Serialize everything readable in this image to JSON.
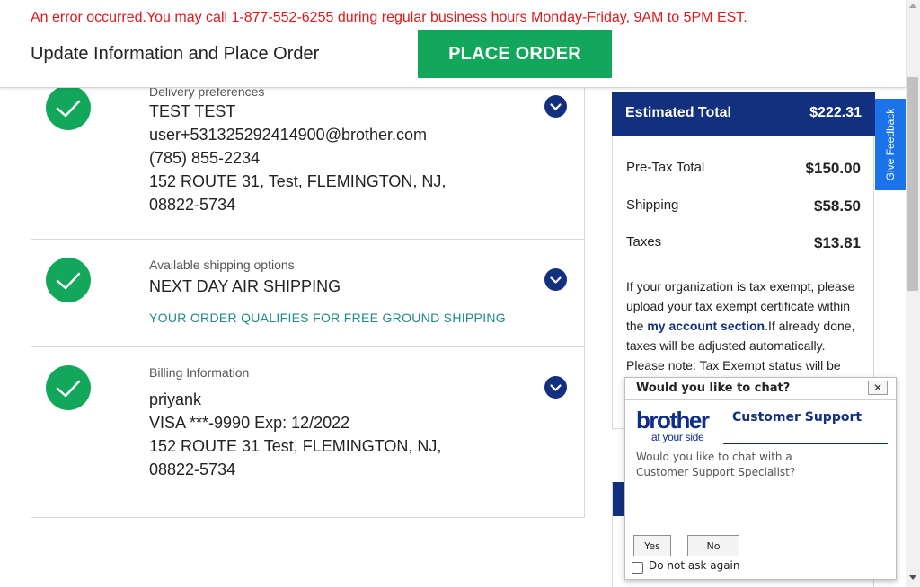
{
  "header": {
    "error_message": "An error occurred.You may call 1-877-552-6255 during regular business hours Monday-Friday, 9AM to 5PM EST.",
    "title": "Update Information and Place Order",
    "place_order_label": "PLACE ORDER"
  },
  "sections": {
    "delivery": {
      "label": "Delivery preferences",
      "lines": [
        "TEST TEST",
        "user+531325292414900@brother.com",
        "(785) 855-2234",
        "152 ROUTE 31, Test, FLEMINGTON, NJ,",
        "08822-5734"
      ]
    },
    "shipping": {
      "label": "Available shipping options",
      "option": "NEXT DAY AIR SHIPPING",
      "note": "YOUR ORDER QUALIFIES FOR FREE GROUND SHIPPING"
    },
    "billing": {
      "label": "Billing Information",
      "lines": [
        "priyank",
        "VISA ***-9990 Exp: 12/2022",
        "152 ROUTE 31 Test, FLEMINGTON, NJ,",
        "08822-5734"
      ]
    }
  },
  "summary": {
    "estimated_total_label": "Estimated Total",
    "estimated_total_value": "$222.31",
    "rows": [
      {
        "label": "Pre-Tax Total",
        "value": "$150.00"
      },
      {
        "label": "Shipping",
        "value": "$58.50"
      },
      {
        "label": "Taxes",
        "value": "$13.81"
      }
    ],
    "tax_note_pre": "If your organization is tax exempt, please upload your tax exempt certificate within the ",
    "tax_note_link": "my account section",
    "tax_note_post": ".If already done, taxes will be adjusted automatically. Please note: Tax Exempt status will be"
  },
  "feedback": {
    "label": "Give Feedback"
  },
  "chat": {
    "title": "Would you like to chat?",
    "close_label": "✕",
    "logo_word": "brother",
    "logo_tag": "at your side",
    "heading": "Customer Support",
    "body": "Would you like to chat with a Customer Support Specialist?",
    "yes_label": "Yes",
    "no_label": "No",
    "dont_ask_label": "Do not ask again"
  },
  "colors": {
    "accent_blue": "#13307e",
    "success_green": "#12a75a",
    "error_red": "#e0191b",
    "feedback_blue": "#1a73e8"
  }
}
